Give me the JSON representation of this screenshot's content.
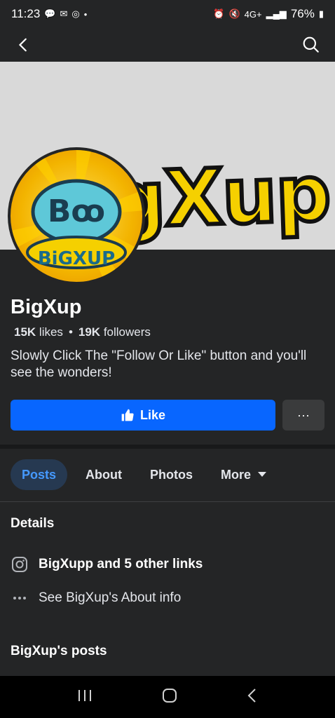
{
  "status_bar": {
    "time": "11:23",
    "battery": "76%",
    "network": "4G+"
  },
  "cover": {
    "brand_text": "BigXup"
  },
  "avatar": {
    "text_top": "Bꝏ",
    "text_bottom": "BiGXUP"
  },
  "profile": {
    "name": "BigXup",
    "likes_count": "15K",
    "likes_label": "likes",
    "separator": "•",
    "followers_count": "19K",
    "followers_label": "followers",
    "bio": "Slowly Click The \"Follow Or Like\" button and you'll see the wonders!"
  },
  "actions": {
    "like_label": "Like",
    "more_label": "···"
  },
  "tabs": [
    {
      "label": "Posts",
      "active": true
    },
    {
      "label": "About"
    },
    {
      "label": "Photos"
    },
    {
      "label": "More"
    }
  ],
  "details": {
    "title": "Details",
    "links_label": "BigXupp and 5 other links",
    "about_label": "See BigXup's About info"
  },
  "posts_section": {
    "title": "BigXup's posts"
  },
  "colors": {
    "accent": "#0866ff",
    "background": "#242526",
    "active_tab_bg": "#263951",
    "active_tab_text": "#4599ff"
  }
}
